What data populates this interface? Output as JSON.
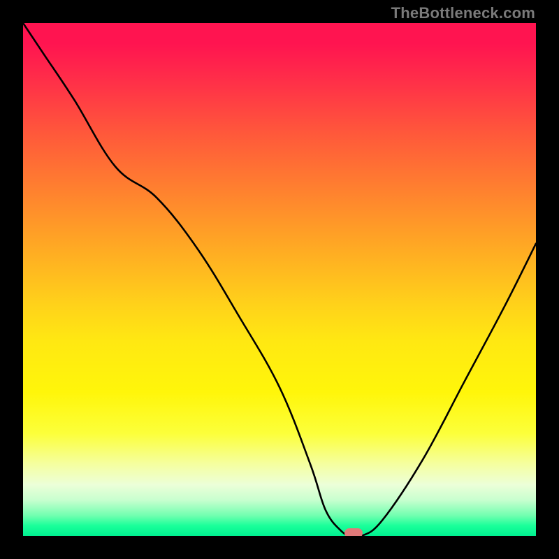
{
  "watermark": "TheBottleneck.com",
  "colors": {
    "bg": "#000000",
    "curve": "#000000",
    "marker": "#e07a7a"
  },
  "chart_data": {
    "type": "line",
    "title": "",
    "xlabel": "",
    "ylabel": "",
    "xlim": [
      0,
      100
    ],
    "ylim": [
      0,
      100
    ],
    "grid": false,
    "legend": false,
    "series": [
      {
        "name": "bottleneck-curve",
        "x": [
          0,
          4,
          10,
          18,
          26,
          34,
          42,
          50,
          56,
          59,
          62,
          64,
          66,
          70,
          78,
          86,
          94,
          100
        ],
        "y": [
          100,
          94,
          85,
          72,
          66,
          56,
          43,
          29,
          14,
          5,
          1,
          0,
          0,
          3,
          15,
          30,
          45,
          57
        ]
      }
    ],
    "marker": {
      "x": 64.5,
      "y": 0
    }
  }
}
